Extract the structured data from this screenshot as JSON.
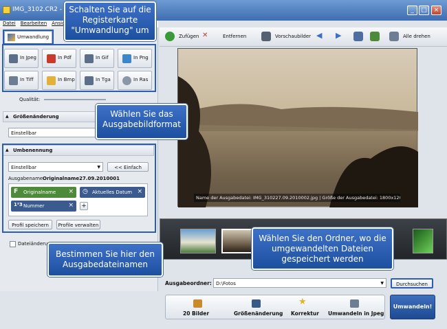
{
  "window": {
    "title": "IMG_3102.CR2 - AVS"
  },
  "menu": [
    "Datei",
    "Bearbeiten",
    "Ansicht"
  ],
  "tab": {
    "label": "Umwandlung"
  },
  "formats": [
    "In Jpeg",
    "In Pdf",
    "In Gif",
    "In Png",
    "In Tiff",
    "In Bmp",
    "In Tga",
    "In Ras"
  ],
  "quality_label": "Qualität:",
  "resize": {
    "header": "Größenänderung",
    "combo": "Einstellbar"
  },
  "rename": {
    "header": "Umbenennung",
    "combo": "Einstellbar",
    "simple_button": "<< Einfach",
    "output_label": "Ausgabename:",
    "output_value": "Originalname27.09.2010001",
    "chips": [
      "Originalname",
      "Aktuelles Datum",
      "Nummer"
    ],
    "save_profile": "Profil speichern",
    "manage_profiles": "Profile verwalten"
  },
  "date_change_label": "Dateiänderun",
  "toolbar": {
    "add": "Zufügen",
    "remove": "Entfernen",
    "preview": "Vorschaubilder",
    "rotate_all": "Alle drehen"
  },
  "preview": {
    "caption": "Name der Ausgabedatei: IMG_310227.09.2010002.jpg | Größe der Ausgabedatei: 1800x1200"
  },
  "output": {
    "label": "Ausgabeordner:",
    "value": "D:\\Fotos",
    "browse": "Durchsuchen"
  },
  "steps": [
    "20 Bilder",
    "Größenänderung",
    "Korrektur",
    "Umwandeln in Jpeg"
  ],
  "convert_button": "Umwandeln!",
  "callouts": {
    "tab": "Schalten Sie auf die Registerkarte \"Umwandlung\" um",
    "format": "Wählen Sie das Ausgabebildformat",
    "filename": "Bestimmen Sie hier den Ausgabedateinamen",
    "folder": "Wählen Sie den Ordner, wo die umgewandelten Dateien gespeichert werden"
  },
  "colors": {
    "accent": "#2a5db6",
    "chip_green": "#4d8a3a",
    "chip_blue": "#3b5b8f"
  }
}
